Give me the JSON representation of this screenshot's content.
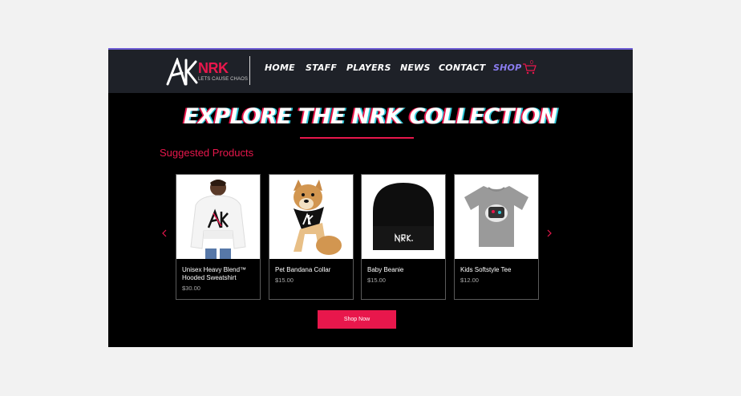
{
  "header": {
    "logo_text": "NRK",
    "logo_tagline": "LETS CAUSE CHAOS",
    "nav": [
      {
        "label": "HOME",
        "active": false
      },
      {
        "label": "STAFF",
        "active": false
      },
      {
        "label": "PLAYERS",
        "active": false
      },
      {
        "label": "NEWS",
        "active": false
      },
      {
        "label": "CONTACT",
        "active": false
      },
      {
        "label": "SHOP",
        "active": true
      }
    ],
    "cart_count": "0",
    "cart_icon": "shopping-cart-icon"
  },
  "main": {
    "title": "EXPLORE THE NRK COLLECTION",
    "section_title": "Suggested Products",
    "prev_icon": "chevron-left-icon",
    "next_icon": "chevron-right-icon",
    "products": [
      {
        "name": "Unisex Heavy Blend™ Hooded Sweatshirt",
        "price": "$30.00",
        "image": "white-hoodie-model"
      },
      {
        "name": "Pet Bandana Collar",
        "price": "$15.00",
        "image": "dog-bandana"
      },
      {
        "name": "Baby Beanie",
        "price": "$15.00",
        "image": "black-beanie"
      },
      {
        "name": "Kids Softstyle Tee",
        "price": "$12.00",
        "image": "grey-tee"
      }
    ],
    "shop_button": "Shop Now"
  },
  "colors": {
    "accent": "#e8174c",
    "nav_active": "#8a7cf0",
    "header_bg": "#1e2128",
    "page_bg": "#000000"
  }
}
